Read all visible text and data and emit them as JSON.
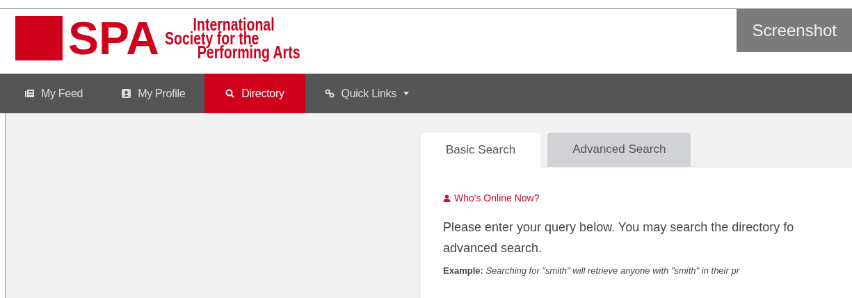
{
  "header": {
    "logo_letters": "SPA",
    "logo_lines": [
      "International",
      "Society for the",
      "Performing Arts"
    ],
    "badge": "Screenshot"
  },
  "nav": [
    {
      "label": "My Feed",
      "kind": "feed",
      "selected": false
    },
    {
      "label": "My Profile",
      "kind": "profile",
      "selected": false
    },
    {
      "label": "Directory",
      "kind": "search",
      "selected": true
    },
    {
      "label": "Quick Links",
      "kind": "link",
      "selected": false,
      "dropdown": true
    }
  ],
  "tabs": [
    {
      "label": "Basic Search",
      "selected": true
    },
    {
      "label": "Advanced Search",
      "selected": false
    }
  ],
  "panel": {
    "online_link": "Who's Online Now?",
    "intro": "Please enter your query below. You may search the directory fo",
    "intro_2": "advanced search.",
    "example_label": "Example:",
    "example_text": "Searching for \"smith\" will retrieve anyone with \"smith\" in their pr"
  }
}
